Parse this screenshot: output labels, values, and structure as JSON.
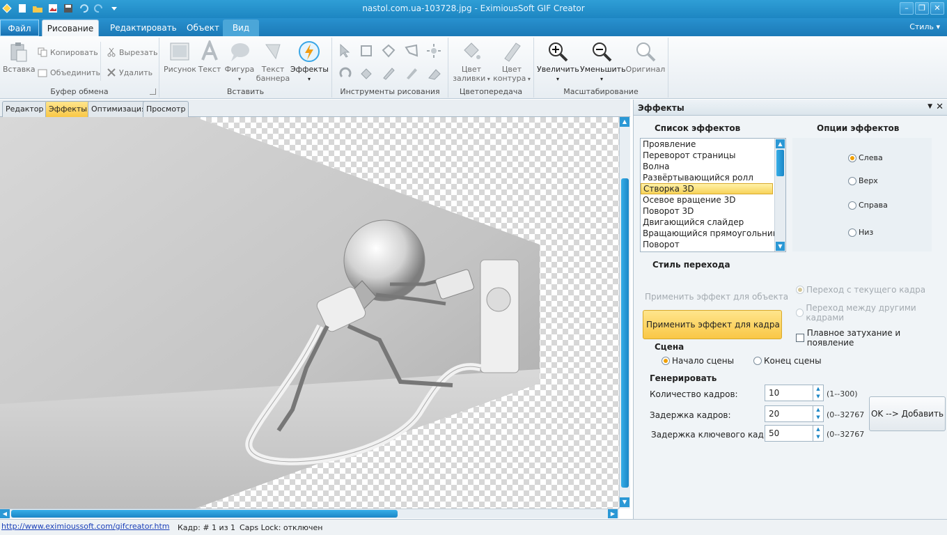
{
  "window": {
    "title": "nastol.com.ua-103728.jpg - EximiousSoft GIF Creator",
    "quick_access": [
      "app-icon",
      "new-icon",
      "open-icon",
      "image-icon",
      "save-icon",
      "undo-icon",
      "redo-icon",
      "customize-icon"
    ]
  },
  "ribbon_tabs": [
    "Файл",
    "Рисование",
    "Редактировать",
    "Объект",
    "Вид"
  ],
  "style_menu": "Стиль ▾",
  "ribbon": {
    "clipboard": {
      "label": "Буфер обмена",
      "paste": "Вставка",
      "copy": "Копировать",
      "merge": "Объединить",
      "cut": "Вырезать",
      "delete": "Удалить"
    },
    "insert": {
      "label": "Вставить",
      "picture": "Рисунок",
      "text": "Текст",
      "shape": "Фигура",
      "banner_text_1": "Текст",
      "banner_text_2": "баннера",
      "effects": "Эффекты"
    },
    "draw_tools": {
      "label": "Инструменты рисования"
    },
    "color": {
      "label": "Цветопередача",
      "fill_1": "Цвет",
      "fill_2": "заливки",
      "outline_1": "Цвет",
      "outline_2": "контура"
    },
    "zoom": {
      "label": "Масштабирование",
      "zoom_in": "Увеличить",
      "zoom_out": "Уменьшить",
      "original": "Оригинал"
    }
  },
  "doc_tabs": [
    "Редактор",
    "Эффекты",
    "Оптимизация",
    "Просмотр"
  ],
  "status": {
    "link": "http://www.eximioussoft.com/gifcreator.htm",
    "frame": "Кадр: # 1 из 1",
    "caps": "Caps Lock: отключен"
  },
  "panel": {
    "title": "Эффекты",
    "list_title": "Список эффектов",
    "options_title": "Опции эффектов",
    "effects": [
      "Проявление",
      "Переворот страницы",
      "Волна",
      "Развёртывающийся ролл",
      "Створка 3D",
      "Осевое вращение 3D",
      "Поворот 3D",
      "Двигающийся слайдер",
      "Вращающийся прямоугольник",
      "Поворот"
    ],
    "selected_effect": "Створка 3D",
    "options": [
      "Слева",
      "Верх",
      "Справа",
      "Низ"
    ],
    "selected_option": "Слева",
    "transition_title": "Стиль перехода",
    "apply_object": "Применить эффект для объекта",
    "apply_frame": "Применить эффект для кадра",
    "from_current": "Переход с текущего кадра",
    "between_frames": "Переход между другими кадрами",
    "fade": "Плавное затухание и появление",
    "scene_title": "Сцена",
    "scene_start": "Начало сцены",
    "scene_end": "Конец сцены",
    "generate_title": "Генерировать",
    "frame_count_label": "Количество кадров:",
    "frame_count": "10",
    "frame_count_range": "(1--300)",
    "frame_delay_label": "Задержка кадров:",
    "frame_delay": "20",
    "frame_delay_range": "(0--32767",
    "key_delay_label": "Задержка ключевого кадра:",
    "key_delay": "50",
    "key_delay_range": "(0--32767",
    "ok_button": "OK --> Добавить"
  },
  "colors": {
    "accent": "#1d86c2",
    "highlight": "#f9c746",
    "checker": "#d7d7d7"
  }
}
